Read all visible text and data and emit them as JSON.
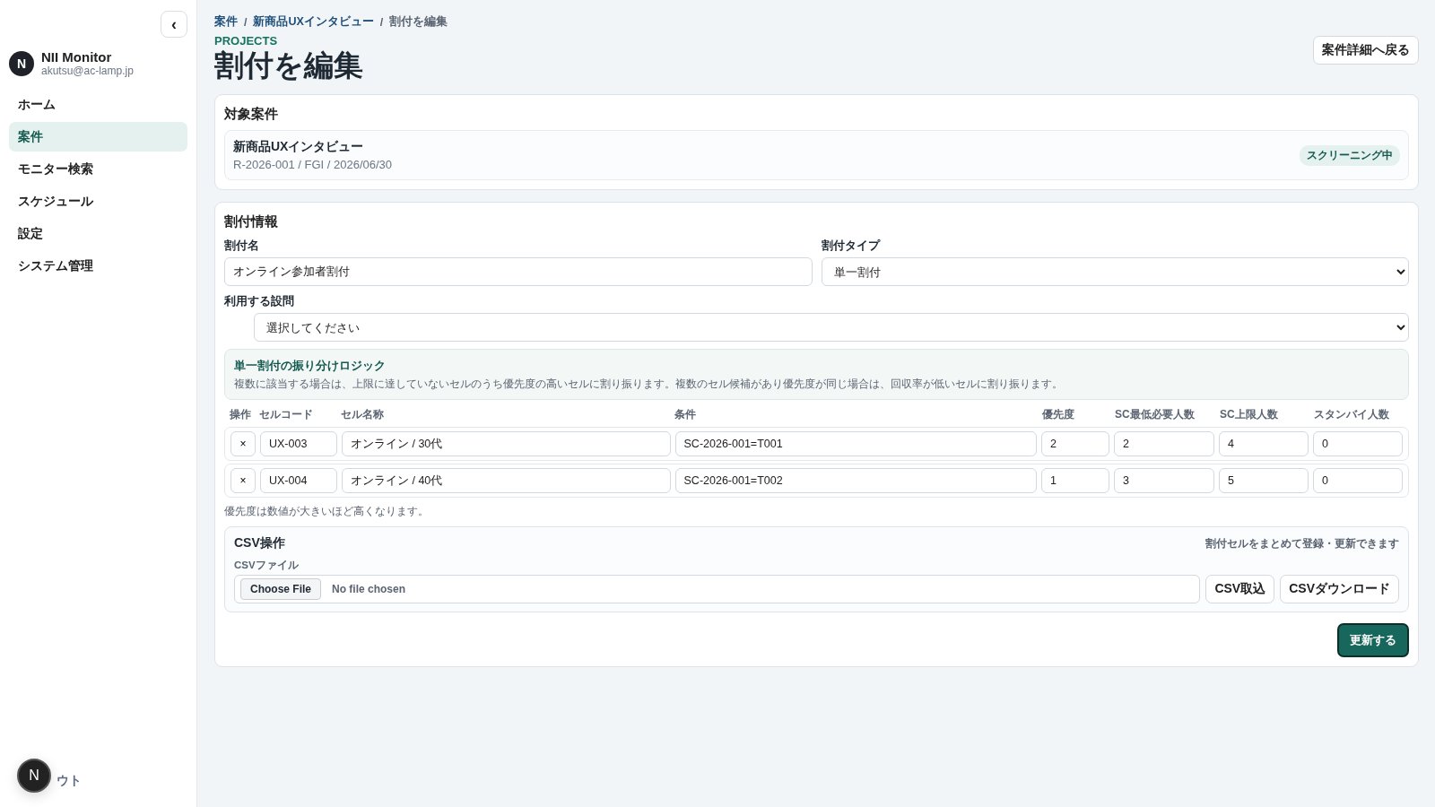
{
  "sidebar": {
    "collapse_button": "‹",
    "brand": {
      "initial": "N",
      "name": "NII Monitor",
      "email": "akutsu@ac-lamp.jp"
    },
    "items": [
      {
        "label": "ホーム",
        "selected": false
      },
      {
        "label": "案件",
        "selected": true
      },
      {
        "label": "モニター検索",
        "selected": false
      },
      {
        "label": "スケジュール",
        "selected": false
      },
      {
        "label": "設定",
        "selected": false
      },
      {
        "label": "システム管理",
        "selected": false
      }
    ],
    "logout": "ウト",
    "dev_badge": "N"
  },
  "breadcrumb_separator": "/",
  "breadcrumb": [
    {
      "label": "案件",
      "link": true
    },
    {
      "label": "新商品UXインタビュー",
      "link": true
    },
    {
      "label": "割付を編集",
      "link": false
    }
  ],
  "eyebrow": "PROJECTS",
  "title": "割付を編集",
  "back_button": "案件詳細へ戻る",
  "target": {
    "heading": "対象案件",
    "name": "新商品UXインタビュー",
    "meta": "R-2026-001 / FGI / 2026/06/30",
    "status": "スクリーニング中"
  },
  "form": {
    "heading": "割付情報",
    "name_field": {
      "label": "割付名",
      "value": "オンライン参加者割付"
    },
    "type_field": {
      "label": "割付タイプ",
      "value": "単一割付"
    },
    "question_field": {
      "label": "利用する設問",
      "value": "選択してください"
    },
    "logic": {
      "title": "単一割付の振り分けロジック",
      "text": "複数に該当する場合は、上限に達していないセルのうち優先度の高いセルに割り振ります。複数のセル候補があり優先度が同じ場合は、回収率が低いセルに割り振ります。"
    },
    "table": {
      "columns": [
        "操作",
        "セルコード",
        "セル名称",
        "条件",
        "優先度",
        "SC最低必要人数",
        "SC上限人数",
        "スタンバイ人数"
      ],
      "rows": [
        {
          "remove": "×",
          "code": "UX-003",
          "name": "オンライン / 30代",
          "condition": "SC-2026-001=T001",
          "priority": "2",
          "sc_min": "2",
          "sc_max": "4",
          "standby": "0"
        },
        {
          "remove": "×",
          "code": "UX-004",
          "name": "オンライン / 40代",
          "condition": "SC-2026-001=T002",
          "priority": "1",
          "sc_min": "3",
          "sc_max": "5",
          "standby": "0"
        }
      ]
    },
    "note": "優先度は数値が大きいほど高くなります。",
    "csv": {
      "heading": "CSV操作",
      "hint": "割付セルをまとめて登録・更新できます",
      "file_label": "CSVファイル",
      "choose_button": "Choose File",
      "file_status": "No file chosen",
      "import_button": "CSV取込",
      "download_button": "CSVダウンロード"
    },
    "submit": "更新する"
  }
}
